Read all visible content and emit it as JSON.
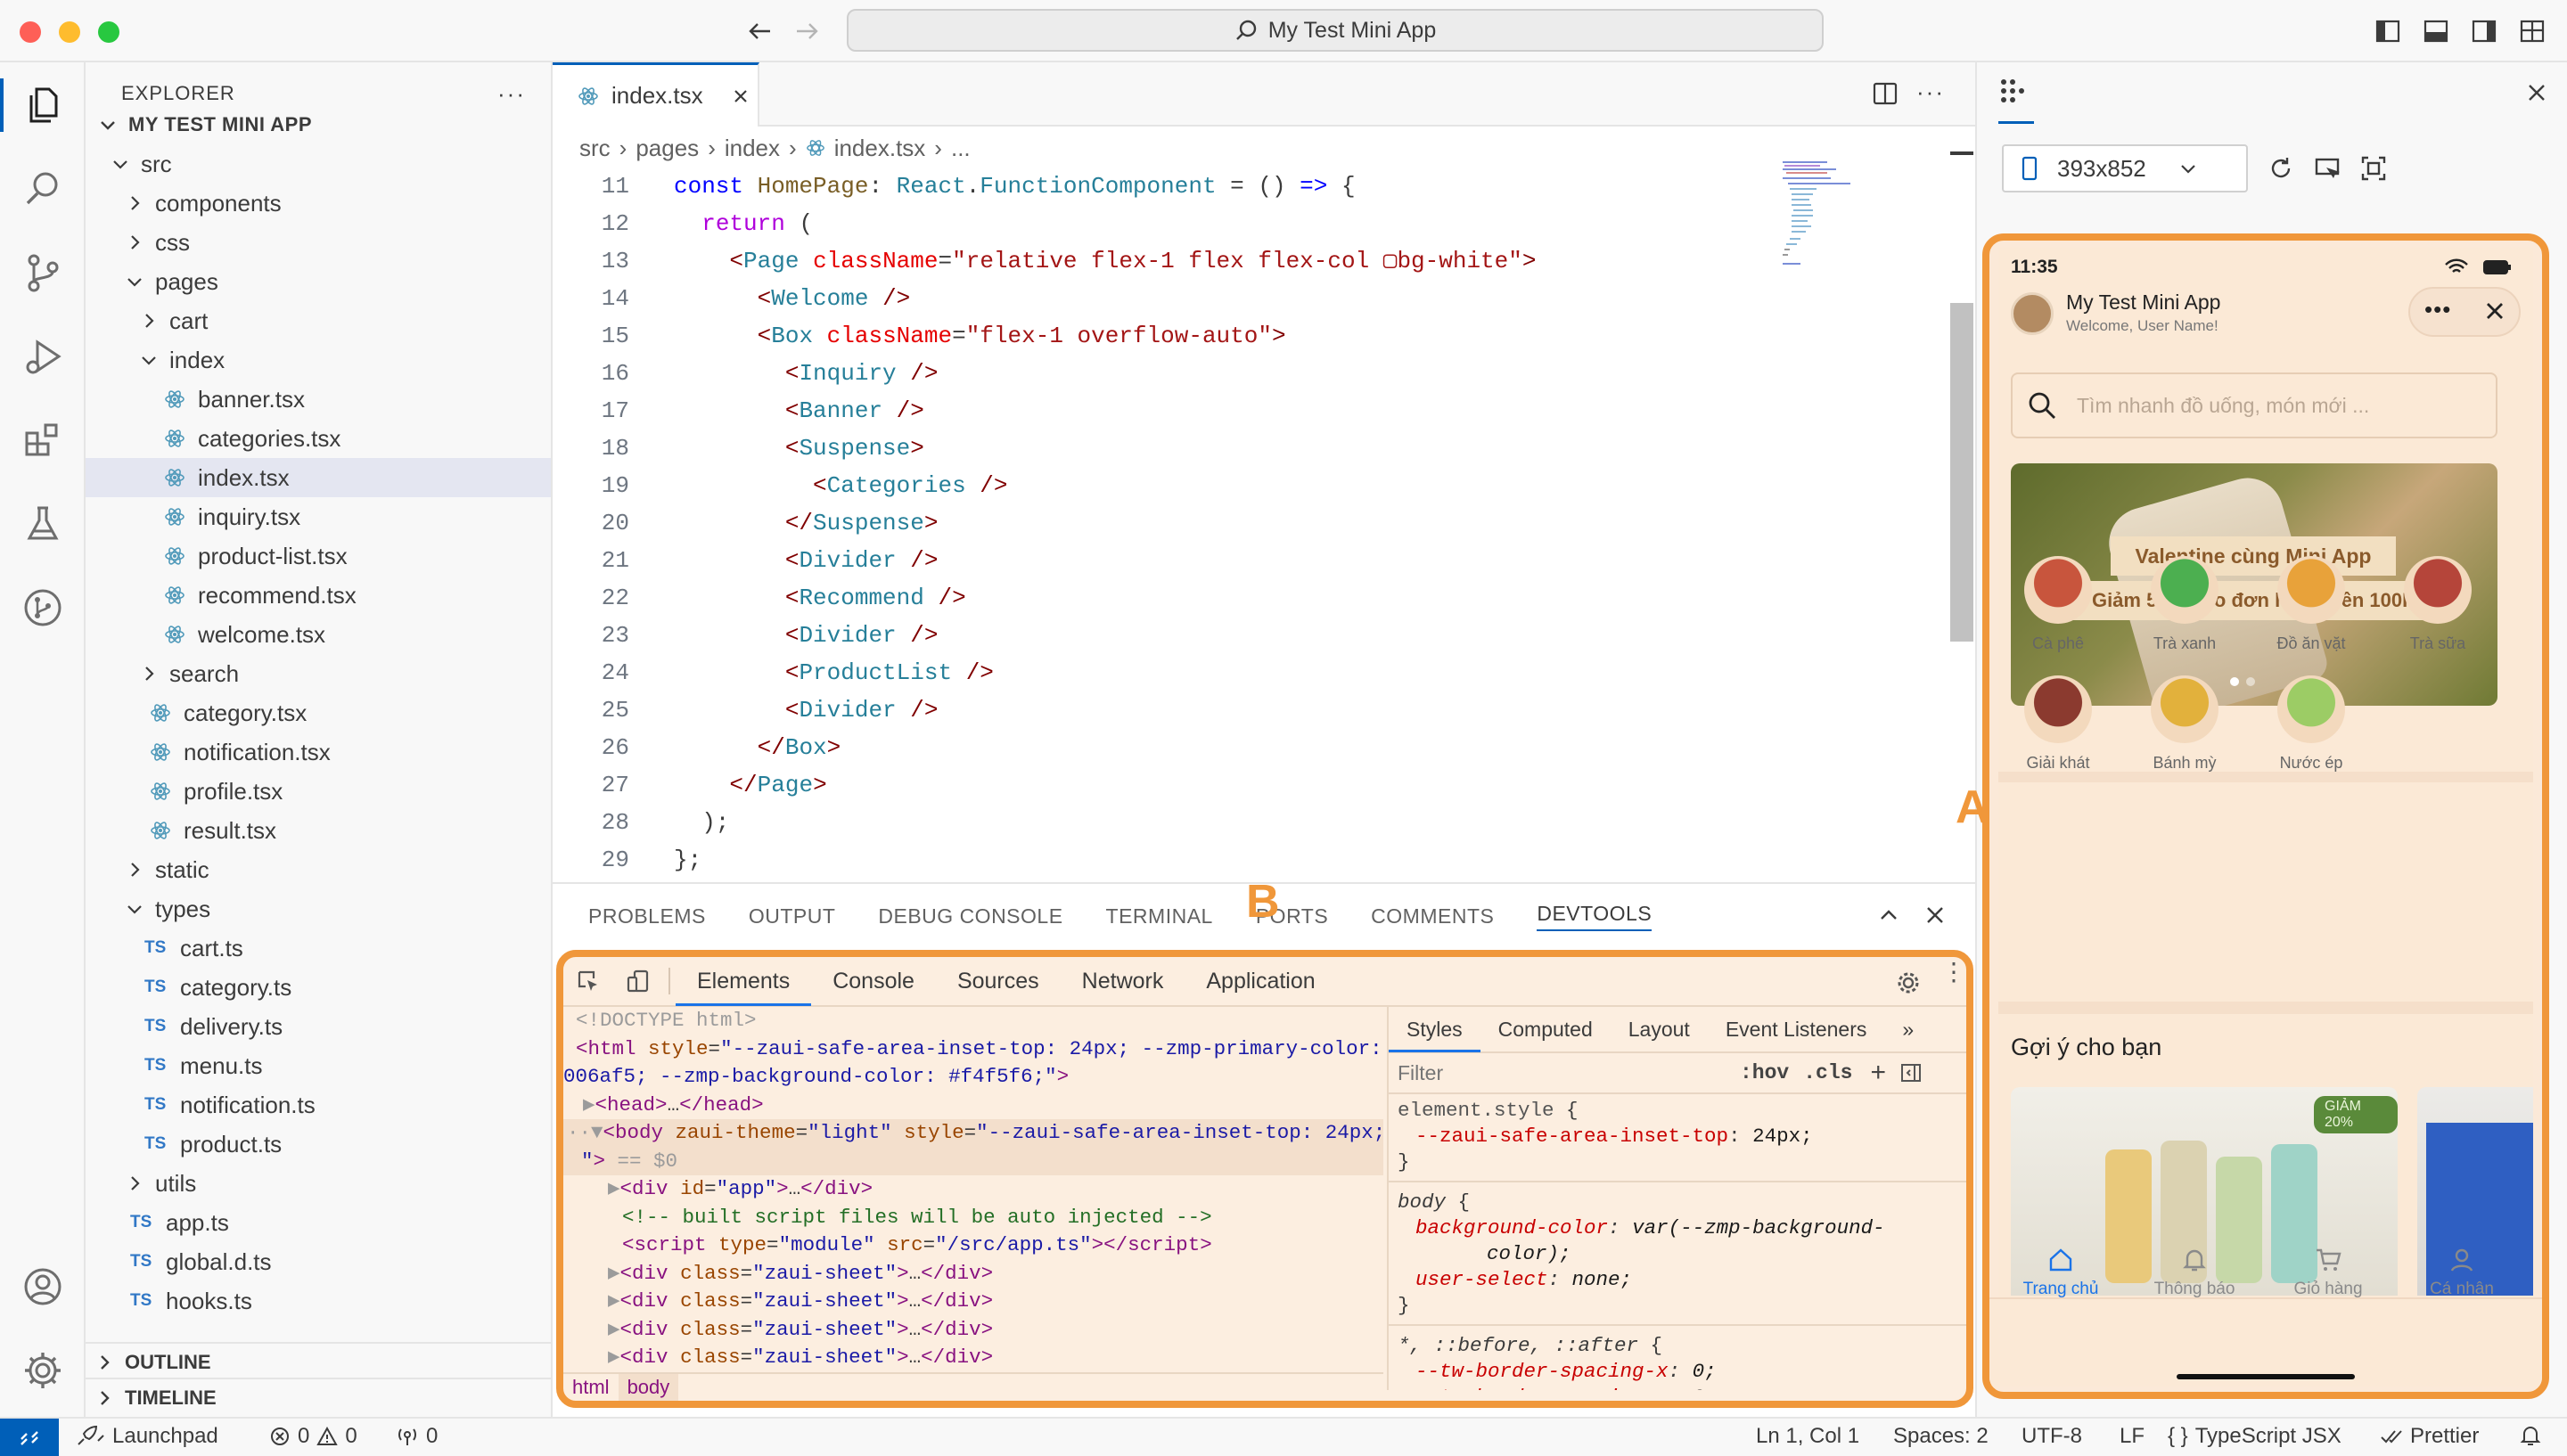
{
  "window": {
    "title": "My Test Mini App"
  },
  "sidebar": {
    "title": "EXPLORER",
    "project": "MY TEST MINI APP",
    "tree": [
      {
        "label": "src",
        "kind": "folder-open",
        "depth": 0
      },
      {
        "label": "components",
        "kind": "folder",
        "depth": 1
      },
      {
        "label": "css",
        "kind": "folder",
        "depth": 1
      },
      {
        "label": "pages",
        "kind": "folder-open",
        "depth": 1
      },
      {
        "label": "cart",
        "kind": "folder",
        "depth": 2
      },
      {
        "label": "index",
        "kind": "folder-open",
        "depth": 2
      },
      {
        "label": "banner.tsx",
        "kind": "react",
        "depth": 3
      },
      {
        "label": "categories.tsx",
        "kind": "react",
        "depth": 3
      },
      {
        "label": "index.tsx",
        "kind": "react",
        "depth": 3,
        "selected": true
      },
      {
        "label": "inquiry.tsx",
        "kind": "react",
        "depth": 3
      },
      {
        "label": "product-list.tsx",
        "kind": "react",
        "depth": 3
      },
      {
        "label": "recommend.tsx",
        "kind": "react",
        "depth": 3
      },
      {
        "label": "welcome.tsx",
        "kind": "react",
        "depth": 3
      },
      {
        "label": "search",
        "kind": "folder",
        "depth": 2
      },
      {
        "label": "category.tsx",
        "kind": "react",
        "depth": 2
      },
      {
        "label": "notification.tsx",
        "kind": "react",
        "depth": 2
      },
      {
        "label": "profile.tsx",
        "kind": "react",
        "depth": 2
      },
      {
        "label": "result.tsx",
        "kind": "react",
        "depth": 2
      },
      {
        "label": "static",
        "kind": "folder",
        "depth": 1
      },
      {
        "label": "types",
        "kind": "folder-open",
        "depth": 1
      },
      {
        "label": "cart.ts",
        "kind": "ts",
        "depth": 2
      },
      {
        "label": "category.ts",
        "kind": "ts",
        "depth": 2
      },
      {
        "label": "delivery.ts",
        "kind": "ts",
        "depth": 2
      },
      {
        "label": "menu.ts",
        "kind": "ts",
        "depth": 2
      },
      {
        "label": "notification.ts",
        "kind": "ts",
        "depth": 2
      },
      {
        "label": "product.ts",
        "kind": "ts",
        "depth": 2
      },
      {
        "label": "utils",
        "kind": "folder",
        "depth": 1
      },
      {
        "label": "app.ts",
        "kind": "ts",
        "depth": 1
      },
      {
        "label": "global.d.ts",
        "kind": "ts",
        "depth": 1
      },
      {
        "label": "hooks.ts",
        "kind": "ts",
        "depth": 1
      }
    ],
    "outline": "OUTLINE",
    "timeline": "TIMELINE"
  },
  "editor": {
    "tab": "index.tsx",
    "breadcrumb": [
      "src",
      "pages",
      "index",
      "index.tsx",
      "..."
    ],
    "line_numbers": [
      "11",
      "12",
      "13",
      "14",
      "15",
      "16",
      "17",
      "18",
      "19",
      "20",
      "21",
      "22",
      "23",
      "24",
      "25",
      "26",
      "27",
      "28",
      "29"
    ]
  },
  "panel": {
    "tabs": [
      "PROBLEMS",
      "OUTPUT",
      "DEBUG CONSOLE",
      "TERMINAL",
      "PORTS",
      "COMMENTS",
      "DEVTOOLS"
    ],
    "active_tab": "DEVTOOLS",
    "devtools": {
      "tabs": [
        "Elements",
        "Console",
        "Sources",
        "Network",
        "Application"
      ],
      "styles_tabs": [
        "Styles",
        "Computed",
        "Layout",
        "Event Listeners"
      ],
      "filter_placeholder": "Filter",
      "hov": ":hov",
      "cls": ".cls",
      "crumbs": [
        "html",
        "body"
      ]
    }
  },
  "annotations": {
    "a": "A",
    "b": "B"
  },
  "simulator": {
    "device": "393x852",
    "time": "11:35",
    "app_name": "My Test Mini App",
    "welcome": "Welcome, User Name!",
    "search_placeholder": "Tìm nhanh đồ uống, món mới ...",
    "banner_line1": "Valentine cùng Mini App",
    "banner_line2": "Giảm 50% cho đơn hàng trên 100K",
    "categories": [
      "Cà phê",
      "Trà xanh",
      "Đồ ăn vặt",
      "Trà sữa",
      "Giải khát",
      "Bánh mỳ",
      "Nước ép"
    ],
    "category_colors": [
      "#c8553d",
      "#4caf50",
      "#e8a23a",
      "#b5453a",
      "#8b3a2f",
      "#e2b13c",
      "#9ccc65"
    ],
    "recommend_title": "Gợi ý cho bạn",
    "discount_badge": "GIẢM 20%",
    "nav": [
      "Trang chủ",
      "Thông báo",
      "Giỏ hàng",
      "Cá nhân"
    ]
  },
  "statusbar": {
    "launchpad": "Launchpad",
    "errors": "0",
    "warnings": "0",
    "ports": "0",
    "position": "Ln 1, Col 1",
    "spaces": "Spaces: 2",
    "encoding": "UTF-8",
    "eol": "LF",
    "language": "TypeScript JSX",
    "prettier": "Prettier"
  },
  "colors": {
    "accent": "#005fb8",
    "annotation": "#f0973a"
  }
}
